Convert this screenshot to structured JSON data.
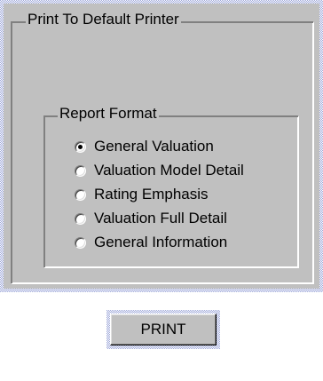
{
  "print_group": {
    "title": "Print To Default Printer"
  },
  "report_format": {
    "title": "Report Format",
    "options": [
      {
        "label": "General Valuation",
        "selected": true
      },
      {
        "label": "Valuation Model Detail",
        "selected": false
      },
      {
        "label": "Rating Emphasis",
        "selected": false
      },
      {
        "label": "Valuation Full Detail",
        "selected": false
      },
      {
        "label": "General Information",
        "selected": false
      }
    ]
  },
  "print_button": {
    "label": "PRINT"
  }
}
